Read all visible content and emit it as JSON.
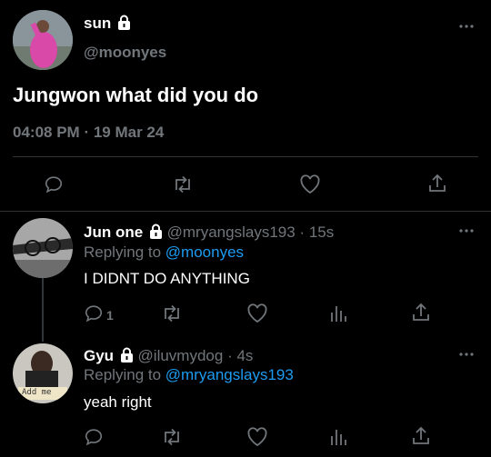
{
  "main_tweet": {
    "display_name": "sun",
    "handle": "@moonyes",
    "text": "Jungwon what did you do",
    "time": "04:08 PM",
    "separator": "·",
    "date": "19 Mar 24"
  },
  "reply1": {
    "display_name": "Jun one",
    "handle": "@mryangslays193",
    "dot": "·",
    "time": "15s",
    "replying_prefix": "Replying to",
    "replying_to": "@moonyes",
    "text": "I DIDNT DO ANYTHING",
    "reply_count": "1"
  },
  "reply2": {
    "display_name": "Gyu",
    "handle": "@iluvmydog",
    "dot": "·",
    "time": "4s",
    "replying_prefix": "Replying to",
    "replying_to": "@mryangslays193",
    "text": "yeah right",
    "avatar_sign_text": "Add me"
  },
  "icons": [
    "lock-icon",
    "reply-icon",
    "retweet-icon",
    "like-icon",
    "share-icon",
    "views-icon",
    "more-icon"
  ],
  "colors": {
    "background": "#000000",
    "text": "#ffffff",
    "muted": "#71767b",
    "link": "#1d9bf0",
    "divider": "#2f3336"
  }
}
